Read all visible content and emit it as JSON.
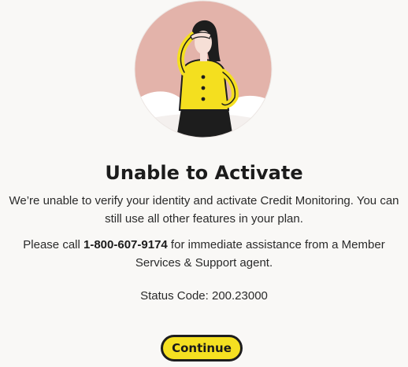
{
  "illustration": {
    "icon": "woman-shading-eyes-illustration",
    "colors": {
      "circle_bg": "#e3b3aa",
      "clouds": "#ffffff",
      "jacket": "#f4df1f",
      "skirt": "#1d1d1d",
      "hair": "#1d1d1d",
      "skin": "#f6dfd6"
    }
  },
  "dialog": {
    "title": "Unable to Activate",
    "message_line1": "We’re unable to verify your identity and activate Credit Monitoring. You can",
    "message_line2": "still use all other features in your plan.",
    "call_prefix": "Please call ",
    "phone": "1-800-607-9174",
    "call_suffix_line1": " for immediate assistance from a Member",
    "call_line2": "Services & Support agent.",
    "status_code": "Status Code: 200.23000",
    "continue_label": "Continue"
  },
  "colors": {
    "background": "#f9f8f6",
    "button_bg": "#f5e021",
    "button_border": "#1d1d1d",
    "text": "#2a2a2a"
  }
}
